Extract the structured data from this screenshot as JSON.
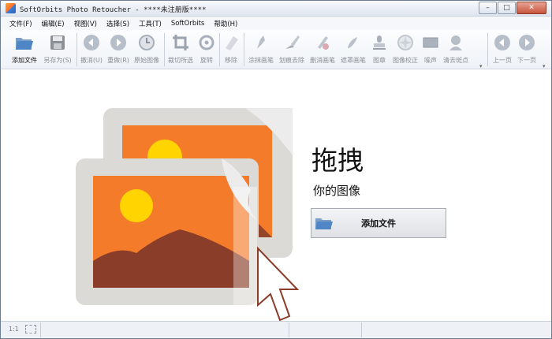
{
  "window": {
    "title": "SoftOrbits Photo Retoucher - ****未注册版****",
    "controls": {
      "minimize": "–",
      "maximize": "□",
      "close": "✕"
    }
  },
  "menu": [
    "文件(F)",
    "编辑(E)",
    "视图(V)",
    "选择(S)",
    "工具(T)",
    "SoftOrbits",
    "帮助(H)"
  ],
  "toolbar": {
    "items": [
      {
        "label": "添加文件",
        "icon": "open-folder-icon",
        "active": true
      },
      {
        "label": "另存为(S)",
        "icon": "save-icon",
        "active": false
      },
      {
        "label": "撤消(U)",
        "icon": "undo-icon",
        "active": false
      },
      {
        "label": "重做(R)",
        "icon": "redo-icon",
        "active": false
      },
      {
        "label": "原始图像",
        "icon": "original-image-icon",
        "active": false
      },
      {
        "label": "裁切所选",
        "icon": "crop-icon",
        "active": false
      },
      {
        "label": "旋转",
        "icon": "rotate-icon",
        "active": false
      },
      {
        "label": "移除",
        "icon": "remove-icon",
        "active": false
      },
      {
        "label": "涂抹画笔",
        "icon": "smudge-brush-icon",
        "active": false
      },
      {
        "label": "划痕去除",
        "icon": "scratch-removal-icon",
        "active": false
      },
      {
        "label": "删消画笔",
        "icon": "erase-brush-icon",
        "active": false
      },
      {
        "label": "遮罩画笔",
        "icon": "mask-brush-icon",
        "active": false
      },
      {
        "label": "图章",
        "icon": "stamp-icon",
        "active": false
      },
      {
        "label": "图像校正",
        "icon": "image-correction-icon",
        "active": false
      },
      {
        "label": "噪声",
        "icon": "noise-icon",
        "active": false
      },
      {
        "label": "清去斑点",
        "icon": "spot-removal-icon",
        "active": false
      },
      {
        "label": "上一页",
        "icon": "previous-page-icon",
        "active": false
      },
      {
        "label": "下一页",
        "icon": "next-page-icon",
        "active": false
      }
    ]
  },
  "main": {
    "heading": "拖拽",
    "subheading": "你的图像",
    "add_files_button": "添加文件"
  },
  "status": {
    "zoom": "1:1"
  },
  "colors": {
    "accent_orange": "#f47b2a",
    "sun": "#ffd400",
    "mountain": "#8a3e2a",
    "frame_gray": "#dcdcdc"
  }
}
